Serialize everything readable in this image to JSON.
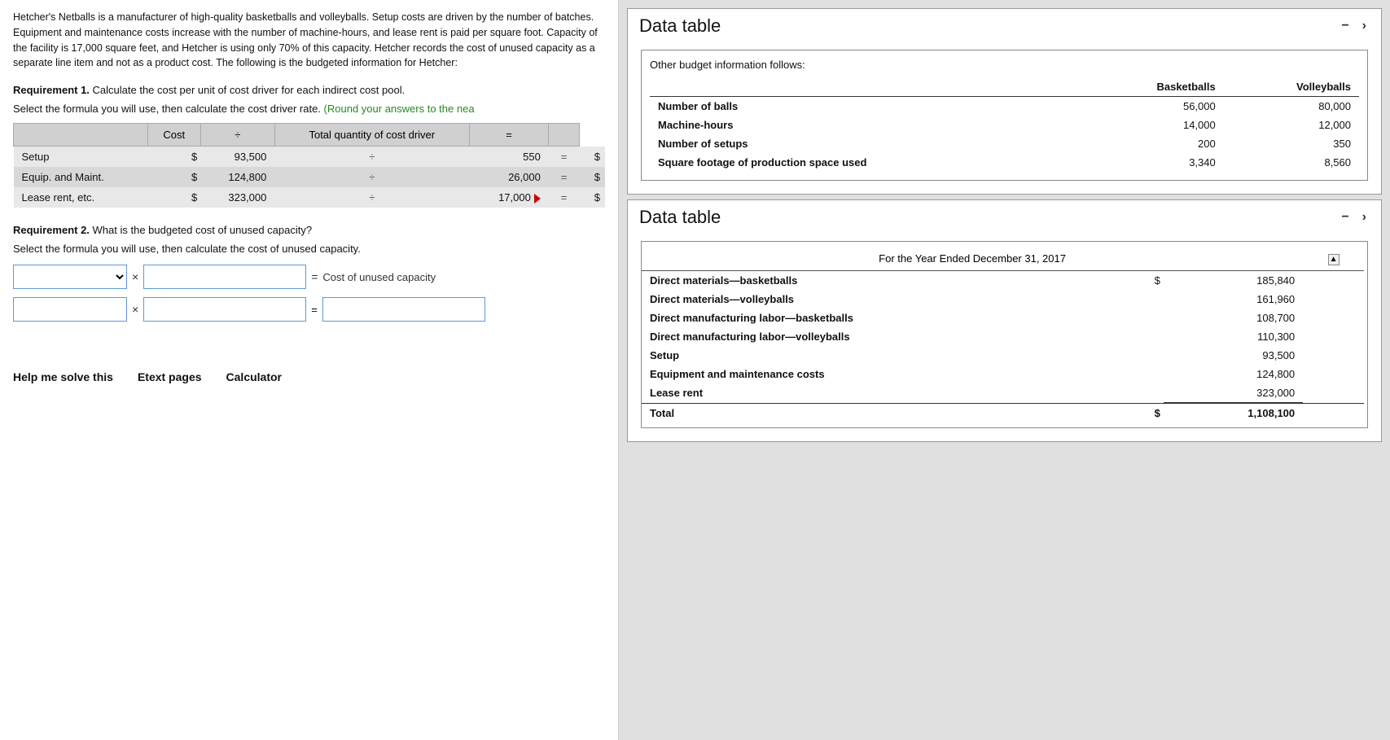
{
  "intro": {
    "text": "Hetcher's Netballs is a manufacturer of high-quality basketballs and volleyballs. Setup costs are driven by the number of batches. Equipment and maintenance costs increase with the number of machine-hours, and lease rent is paid per square foot. Capacity of the facility is 17,000 square feet, and Hetcher is using only 70% of this capacity. Hetcher records the cost of unused capacity as a separate line item and not as a product cost. The following is the budgeted information for Hetcher:"
  },
  "requirement1": {
    "heading": "Requirement 1.",
    "heading_text": " Calculate the cost per unit of cost driver for each indirect cost pool.",
    "instruction": "Select the formula you will use, then calculate the cost driver rate.",
    "instruction_green": "(Round your answers to the nea"
  },
  "cost_table": {
    "col_cost": "Cost",
    "col_div": "÷",
    "col_qty": "Total quantity of cost driver",
    "col_eq": "=",
    "rows": [
      {
        "label": "Setup",
        "dollar": "$",
        "cost": "93,500",
        "div": "÷",
        "qty": "550",
        "eq": "=",
        "result": "$"
      },
      {
        "label": "Equip. and Maint.",
        "dollar": "$",
        "cost": "124,800",
        "div": "÷",
        "qty": "26,000",
        "eq": "=",
        "result": "$"
      },
      {
        "label": "Lease rent, etc.",
        "dollar": "$",
        "cost": "323,000",
        "div": "÷",
        "qty": "17,000",
        "eq": "=",
        "result": "$"
      }
    ]
  },
  "requirement2": {
    "heading": "Requirement 2.",
    "heading_text": " What is the budgeted cost of unused capacity?",
    "instruction": "Select the formula you will use, then calculate the cost of unused capacity.",
    "formula_label": "Cost of unused capacity",
    "row2_eq": "="
  },
  "bottom_links": {
    "help": "Help me solve this",
    "etext": "Etext pages",
    "calculator": "Calculator"
  },
  "data_table1": {
    "title": "Data table",
    "subtitle": "Other budget information follows:",
    "columns": [
      "",
      "Basketballs",
      "Volleyballs"
    ],
    "rows": [
      {
        "label": "Number of balls",
        "b": "56,000",
        "v": "80,000"
      },
      {
        "label": "Machine-hours",
        "b": "14,000",
        "v": "12,000"
      },
      {
        "label": "Number of setups",
        "b": "200",
        "v": "350"
      },
      {
        "label": "Square footage of production space used",
        "b": "3,340",
        "v": "8,560"
      }
    ]
  },
  "data_table2": {
    "title": "Data table",
    "period": "For the Year Ended December 31, 2017",
    "rows": [
      {
        "label": "Direct materials—basketballs",
        "dollar": "$",
        "amount": "185,840"
      },
      {
        "label": "Direct materials—volleyballs",
        "dollar": "",
        "amount": "161,960"
      },
      {
        "label": "Direct manufacturing labor—basketballs",
        "dollar": "",
        "amount": "108,700"
      },
      {
        "label": "Direct manufacturing labor—volleyballs",
        "dollar": "",
        "amount": "110,300"
      },
      {
        "label": "Setup",
        "dollar": "",
        "amount": "93,500"
      },
      {
        "label": "Equipment and maintenance costs",
        "dollar": "",
        "amount": "124,800"
      },
      {
        "label": "Lease rent",
        "dollar": "",
        "amount": "323,000"
      },
      {
        "label": "Total",
        "dollar": "$",
        "amount": "1,108,100",
        "is_total": true
      }
    ]
  }
}
